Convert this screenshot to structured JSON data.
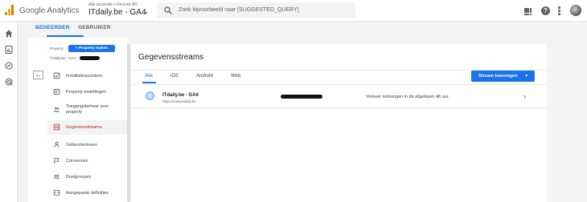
{
  "app": {
    "title": "Google Analytics"
  },
  "account": {
    "breadcrumb": "Alle accounts > FecLink BV",
    "name": "ITdaily.be - GA4"
  },
  "search": {
    "placeholder": "Zoek bijvoorbeeld naar [SUGGESTED_QUERY]",
    "icon": "search-icon"
  },
  "toolbar": {
    "icons": [
      "apps-icon",
      "help-icon",
      "more-vert-icon",
      "avatar"
    ],
    "help_glyph": "?"
  },
  "rail": {
    "icons": [
      "home-icon",
      "reports-icon",
      "explore-icon",
      "advertising-icon"
    ]
  },
  "admin_tabs": [
    {
      "label": "BEHEERDER",
      "active": true
    },
    {
      "label": "GEBRUIKER",
      "active": false
    }
  ],
  "property": {
    "label": "Property",
    "create_button": "+ Property maken",
    "name": "ITdaily.be - GA4"
  },
  "nav": {
    "back_glyph": "←",
    "items": [
      {
        "label": "Installatieassistent",
        "icon": "checklist-icon",
        "active": false
      },
      {
        "label": "Property-instellingen",
        "icon": "settings-panel-icon",
        "active": false
      },
      {
        "label": "Toegangsbeheer voor property",
        "icon": "people-icon",
        "active": false
      },
      {
        "label": "Gegevensstreams",
        "icon": "data-streams-icon",
        "active": true
      },
      {
        "label": "Gebeurtenissen",
        "icon": "events-icon",
        "active": false
      },
      {
        "label": "Conversies",
        "icon": "flag-icon",
        "active": false
      },
      {
        "label": "Doelgroepen",
        "icon": "audiences-icon",
        "active": false
      },
      {
        "label": "Aangepaste definities",
        "icon": "custom-definitions-icon",
        "active": false
      }
    ]
  },
  "main": {
    "title": "Gegevensstreams",
    "filters": [
      {
        "label": "Alle",
        "active": true
      },
      {
        "label": "iOS",
        "active": false
      },
      {
        "label": "Android",
        "active": false
      },
      {
        "label": "Web",
        "active": false
      }
    ],
    "add_button": "Stream toevoegen",
    "add_caret": "▾",
    "streams": [
      {
        "name": "ITdaily.be - GA4",
        "url": "https://www.itdaily.be",
        "status": "Verkeer ontvangen in de afgelopen 48 uur.",
        "icon": "web-icon",
        "chevron": "›"
      }
    ]
  },
  "colors": {
    "accent": "#1a73e8",
    "active_nav": "#c5221f",
    "brand_orange": "#e37400"
  }
}
